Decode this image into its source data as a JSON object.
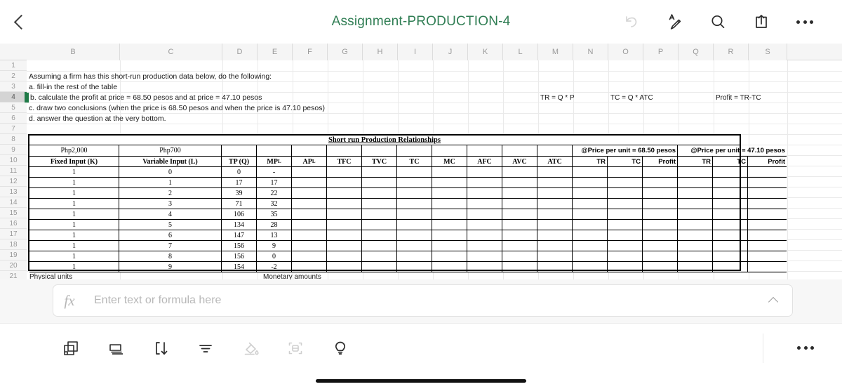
{
  "app": {
    "title": "Assignment-PRODUCTION-4",
    "accent": "#2f7d53",
    "back_icon": "chevron-left-icon"
  },
  "toolbar_top": {
    "items": [
      {
        "name": "undo-icon",
        "label": "Undo",
        "disabled": true
      },
      {
        "name": "annotate-icon",
        "label": "Annotate",
        "disabled": false
      },
      {
        "name": "search-icon",
        "label": "Search",
        "disabled": false
      },
      {
        "name": "share-icon",
        "label": "Share",
        "disabled": false
      },
      {
        "name": "more-icon",
        "label": "More",
        "disabled": false
      }
    ]
  },
  "sheet": {
    "columns": [
      "B",
      "C",
      "D",
      "E",
      "F",
      "G",
      "H",
      "I",
      "J",
      "K",
      "L",
      "M",
      "N",
      "O",
      "P",
      "Q",
      "R",
      "S"
    ],
    "rows": [
      "1",
      "2",
      "3",
      "4",
      "5",
      "6",
      "7",
      "8",
      "9",
      "10",
      "11",
      "12",
      "13",
      "14",
      "15",
      "16",
      "17",
      "18",
      "19",
      "20",
      "21"
    ],
    "selected_row": "4",
    "notes": {
      "row2": "Assuming a firm has this short-run production data below, do the following:",
      "row3": "a. fill-in the rest of the table",
      "row4": "b. calculate the profit at price = 68.50 pesos and at price = 47.10 pesos",
      "row5": "c. draw two conclusions (when the price is  68.50 pesos and when the price is 47.10 pesos)",
      "row6": "d. answer the question at the very bottom."
    },
    "formulas": {
      "tr": "TR = Q * P",
      "tc": "TC = Q * ATC",
      "profit": "Profit = TR-TC"
    },
    "footer_left": "Physical units",
    "footer_right": "Monetary amounts"
  },
  "table": {
    "title": "Short run Production Relationships",
    "cost_labels": {
      "fixed": "Php2,000",
      "variable": "Php700"
    },
    "price_groups": [
      {
        "label": "@Price per unit =  68.50 pesos",
        "columns": [
          "TR",
          "TC",
          "Profit"
        ]
      },
      {
        "label": "@Price per unit = 47.10 pesos",
        "columns": [
          "TR",
          "TC",
          "Profit"
        ]
      }
    ],
    "headers": [
      "Fixed Input (K)",
      "Variable Input (L)",
      "TP (Q)",
      "MPL",
      "APL",
      "TFC",
      "TVC",
      "TC",
      "MC",
      "AFC",
      "AVC",
      "ATC"
    ],
    "header_sub": {
      "mp": "MP",
      "mp_sub": "L",
      "ap": "AP",
      "ap_sub": "L"
    },
    "rows": [
      {
        "k": "1",
        "l": "0",
        "tp": "0",
        "mp": "-",
        "ap": "",
        "tfc": "",
        "tvc": "",
        "tc": "",
        "mc": "",
        "afc": "",
        "avc": "",
        "atc": "",
        "tr1": "",
        "tc1": "",
        "p1": "",
        "tr2": "",
        "tc2": "",
        "p2": ""
      },
      {
        "k": "1",
        "l": "1",
        "tp": "17",
        "mp": "17",
        "ap": "",
        "tfc": "",
        "tvc": "",
        "tc": "",
        "mc": "",
        "afc": "",
        "avc": "",
        "atc": "",
        "tr1": "",
        "tc1": "",
        "p1": "",
        "tr2": "",
        "tc2": "",
        "p2": ""
      },
      {
        "k": "1",
        "l": "2",
        "tp": "39",
        "mp": "22",
        "ap": "",
        "tfc": "",
        "tvc": "",
        "tc": "",
        "mc": "",
        "afc": "",
        "avc": "",
        "atc": "",
        "tr1": "",
        "tc1": "",
        "p1": "",
        "tr2": "",
        "tc2": "",
        "p2": ""
      },
      {
        "k": "1",
        "l": "3",
        "tp": "71",
        "mp": "32",
        "ap": "",
        "tfc": "",
        "tvc": "",
        "tc": "",
        "mc": "",
        "afc": "",
        "avc": "",
        "atc": "",
        "tr1": "",
        "tc1": "",
        "p1": "",
        "tr2": "",
        "tc2": "",
        "p2": ""
      },
      {
        "k": "1",
        "l": "4",
        "tp": "106",
        "mp": "35",
        "ap": "",
        "tfc": "",
        "tvc": "",
        "tc": "",
        "mc": "",
        "afc": "",
        "avc": "",
        "atc": "",
        "tr1": "",
        "tc1": "",
        "p1": "",
        "tr2": "",
        "tc2": "",
        "p2": ""
      },
      {
        "k": "1",
        "l": "5",
        "tp": "134",
        "mp": "28",
        "ap": "",
        "tfc": "",
        "tvc": "",
        "tc": "",
        "mc": "",
        "afc": "",
        "avc": "",
        "atc": "",
        "tr1": "",
        "tc1": "",
        "p1": "",
        "tr2": "",
        "tc2": "",
        "p2": ""
      },
      {
        "k": "1",
        "l": "6",
        "tp": "147",
        "mp": "13",
        "ap": "",
        "tfc": "",
        "tvc": "",
        "tc": "",
        "mc": "",
        "afc": "",
        "avc": "",
        "atc": "",
        "tr1": "",
        "tc1": "",
        "p1": "",
        "tr2": "",
        "tc2": "",
        "p2": ""
      },
      {
        "k": "1",
        "l": "7",
        "tp": "156",
        "mp": "9",
        "ap": "",
        "tfc": "",
        "tvc": "",
        "tc": "",
        "mc": "",
        "afc": "",
        "avc": "",
        "atc": "",
        "tr1": "",
        "tc1": "",
        "p1": "",
        "tr2": "",
        "tc2": "",
        "p2": ""
      },
      {
        "k": "1",
        "l": "8",
        "tp": "156",
        "mp": "0",
        "ap": "",
        "tfc": "",
        "tvc": "",
        "tc": "",
        "mc": "",
        "afc": "",
        "avc": "",
        "atc": "",
        "tr1": "",
        "tc1": "",
        "p1": "",
        "tr2": "",
        "tc2": "",
        "p2": ""
      },
      {
        "k": "1",
        "l": "9",
        "tp": "154",
        "mp": "-2",
        "ap": "",
        "tfc": "",
        "tvc": "",
        "tc": "",
        "mc": "",
        "afc": "",
        "avc": "",
        "atc": "",
        "tr1": "",
        "tc1": "",
        "p1": "",
        "tr2": "",
        "tc2": "",
        "p2": ""
      }
    ]
  },
  "formula_bar": {
    "fx_label": "fx",
    "placeholder": "Enter text or formula here",
    "value": "",
    "expand_icon": "chevron-up-icon"
  },
  "toolbar_bottom": {
    "items": [
      {
        "name": "duplicate-icon",
        "label": "Duplicate",
        "disabled": false
      },
      {
        "name": "sheets-icon",
        "label": "Sheets",
        "disabled": false
      },
      {
        "name": "insert-down-icon",
        "label": "Insert",
        "disabled": false
      },
      {
        "name": "filter-icon",
        "label": "Filter",
        "disabled": false
      },
      {
        "name": "fill-color-icon",
        "label": "Fill color",
        "disabled": true
      },
      {
        "name": "scan-icon",
        "label": "Scan",
        "disabled": true
      },
      {
        "name": "ideas-icon",
        "label": "Ideas",
        "disabled": false
      }
    ],
    "more_label": "More options"
  }
}
